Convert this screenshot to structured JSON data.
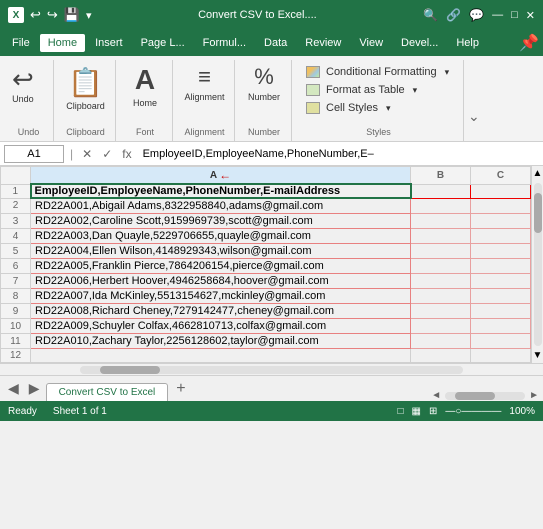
{
  "titleBar": {
    "appName": "Convert CSV to Excel....",
    "dropdownArrow": "▾",
    "quickAccessIcons": [
      "↩",
      "◇",
      "↗"
    ],
    "windowControls": [
      "—",
      "□",
      "✕"
    ]
  },
  "menuBar": {
    "items": [
      "File",
      "Home",
      "Insert",
      "Page Layout",
      "Formulas",
      "Data",
      "Review",
      "View",
      "Developer",
      "Help"
    ],
    "activeItem": "Home"
  },
  "ribbon": {
    "groups": {
      "undo": {
        "label": "Undo",
        "buttons": [
          {
            "icon": "↩",
            "label": "Undo"
          }
        ]
      },
      "clipboard": {
        "label": "Clipboard",
        "icon": "📋"
      },
      "font": {
        "label": "Font",
        "icon": "A"
      },
      "alignment": {
        "label": "Alignment",
        "icon": "≡"
      },
      "number": {
        "label": "Number",
        "icon": "%"
      },
      "styles": {
        "label": "Styles",
        "buttons": [
          {
            "icon": "🎨",
            "label": "Conditional Formatting",
            "arrow": "▾"
          },
          {
            "icon": "📊",
            "label": "Format as Table",
            "arrow": "▾"
          },
          {
            "icon": "🖍",
            "label": "Cell Styles",
            "arrow": "▾"
          }
        ]
      }
    }
  },
  "formulaBar": {
    "cellRef": "A1",
    "cancelBtn": "✕",
    "confirmBtn": "✓",
    "functionBtn": "fx",
    "content": "EmployeeID,EmployeeName,PhoneNumber,E–"
  },
  "spreadsheet": {
    "columns": [
      "A",
      "B",
      "C"
    ],
    "rows": [
      {
        "num": 1,
        "data": "EmployeeID,EmployeeName,PhoneNumber,E-mailAddress",
        "isHeader": true
      },
      {
        "num": 2,
        "data": "RD22A001,Abigail Adams,8322958840,adams@gmail.com"
      },
      {
        "num": 3,
        "data": "RD22A002,Caroline Scott,9159969739,scott@gmail.com"
      },
      {
        "num": 4,
        "data": "RD22A003,Dan Quayle,5229706655,quayle@gmail.com"
      },
      {
        "num": 5,
        "data": "RD22A004,Ellen Wilson,4148929343,wilson@gmail.com"
      },
      {
        "num": 6,
        "data": "RD22A005,Franklin Pierce,7864206154,pierce@gmail.com"
      },
      {
        "num": 7,
        "data": "RD22A006,Herbert Hoover,4946258684,hoover@gmail.com"
      },
      {
        "num": 8,
        "data": "RD22A007,Ida McKinley,5513154627,mckinley@gmail.com"
      },
      {
        "num": 9,
        "data": "RD22A008,Richard Cheney,7279142477,cheney@gmail.com"
      },
      {
        "num": 10,
        "data": "RD22A009,Schuyler Colfax,4662810713,colfax@gmail.com"
      },
      {
        "num": 11,
        "data": "RD22A010,Zachary Taylor,2256128602,taylor@gmail.com"
      },
      {
        "num": 12,
        "data": ""
      }
    ]
  },
  "sheetTabs": {
    "tabs": [
      "Convert CSV to Excel"
    ],
    "addBtn": "+"
  },
  "statusBar": {
    "left": "Ready",
    "sheetInfo": "Sheet 1 of 1",
    "viewBtns": [
      "□",
      "▦",
      "⊞"
    ],
    "zoom": "100%",
    "zoomSlider": 100
  },
  "styles": {
    "conditionalFormatting": "Conditional Formatting",
    "formatTable": "Format as Table",
    "cellStyles": "Cell Styles"
  },
  "colors": {
    "excelGreen": "#217346",
    "redBorder": "#cc0000",
    "headerBg": "#f3f3f3"
  }
}
